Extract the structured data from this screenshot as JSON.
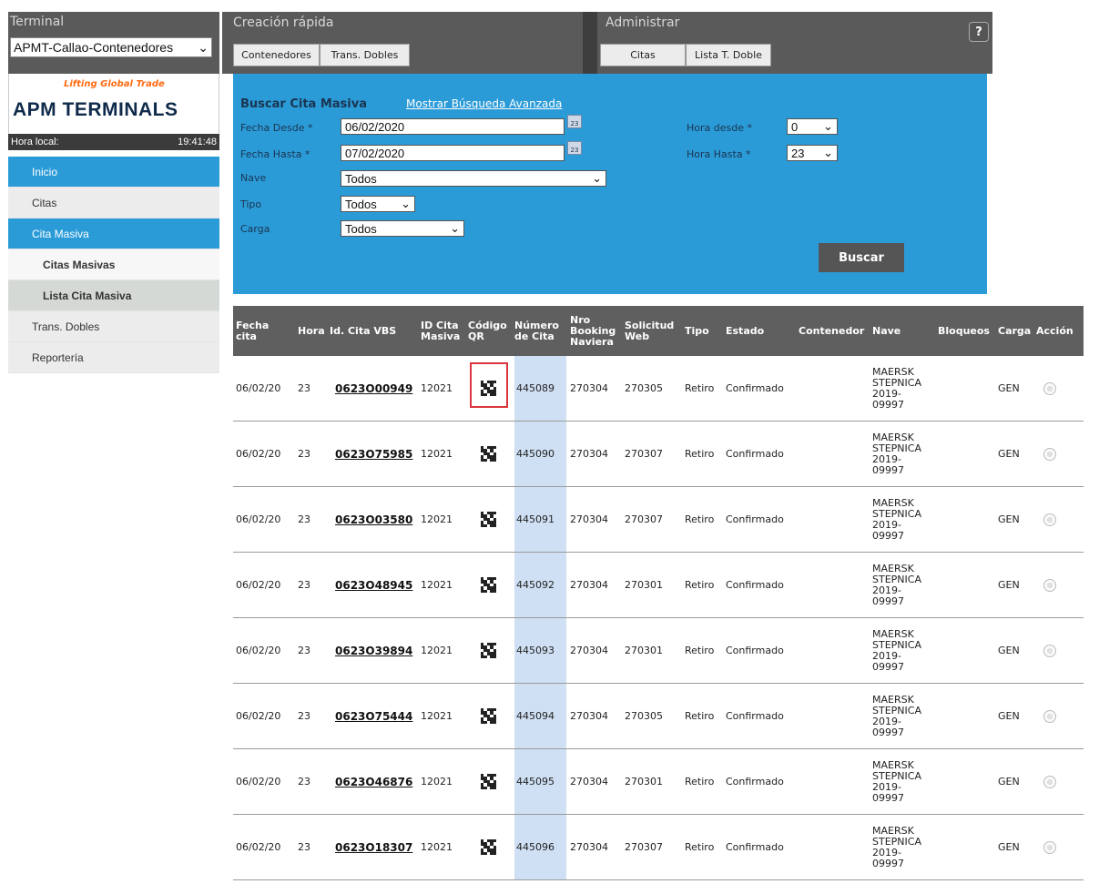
{
  "header": {
    "terminal_title": "Terminal",
    "terminal_value": "APMT-Callao-Contenedores",
    "quick_title": "Creación rápida",
    "quick_buttons": [
      "Contenedores",
      "Trans. Dobles"
    ],
    "admin_title": "Administrar",
    "admin_buttons": [
      "Citas",
      "Lista T. Doble"
    ],
    "help_icon": "help-icon"
  },
  "logo": {
    "tagline": "Lifting Global Trade",
    "name": "APM TERMINALS"
  },
  "local_time": {
    "label": "Hora local:",
    "value": "19:41:48"
  },
  "nav": {
    "items": [
      "Inicio",
      "Citas",
      "Cita Masiva",
      "Citas Masivas",
      "Lista Cita Masiva",
      "Trans. Dobles",
      "Reportería"
    ]
  },
  "search": {
    "title": "Buscar Cita Masiva",
    "advanced_link": "Mostrar Búsqueda Avanzada",
    "fecha_desde_label": "Fecha Desde *",
    "fecha_desde_value": "06/02/2020",
    "fecha_hasta_label": "Fecha Hasta *",
    "fecha_hasta_value": "07/02/2020",
    "nave_label": "Nave",
    "nave_value": "Todos",
    "tipo_label": "Tipo",
    "tipo_value": "Todos",
    "carga_label": "Carga",
    "carga_value": "Todos",
    "hora_desde_label": "Hora desde *",
    "hora_desde_value": "0",
    "hora_hasta_label": "Hora Hasta *",
    "hora_hasta_value": "23",
    "cal_label": "23",
    "buscar_label": "Buscar"
  },
  "table": {
    "headers": {
      "fecha": [
        "Fecha",
        "cita"
      ],
      "hora": "Hora",
      "id_vbs": "Id. Cita VBS",
      "id_masiva": [
        "ID Cita",
        "Masiva"
      ],
      "qr": [
        "Código",
        "QR"
      ],
      "numero": [
        "Número",
        "de Cita"
      ],
      "booking": [
        "Nro",
        "Booking",
        "Naviera"
      ],
      "solicitud": [
        "Solicitud",
        "Web"
      ],
      "tipo": "Tipo",
      "estado": "Estado",
      "contenedor": "Contenedor",
      "nave": "Nave",
      "bloqueos": "Bloqueos",
      "carga": "Carga",
      "accion": "Acción"
    },
    "rows": [
      {
        "fecha": "06/02/20",
        "hora": "23",
        "id_vbs": "0623O00949",
        "id_masiva": "12021",
        "numero": "445089",
        "booking": "270304",
        "solicitud": "270305",
        "tipo": "Retiro",
        "estado": "Confirmado",
        "nave": [
          "MAERSK",
          "STEPNICA",
          "2019-",
          "09997"
        ],
        "carga": "GEN"
      },
      {
        "fecha": "06/02/20",
        "hora": "23",
        "id_vbs": "0623O75985",
        "id_masiva": "12021",
        "numero": "445090",
        "booking": "270304",
        "solicitud": "270307",
        "tipo": "Retiro",
        "estado": "Confirmado",
        "nave": [
          "MAERSK",
          "STEPNICA",
          "2019-",
          "09997"
        ],
        "carga": "GEN"
      },
      {
        "fecha": "06/02/20",
        "hora": "23",
        "id_vbs": "0623O03580",
        "id_masiva": "12021",
        "numero": "445091",
        "booking": "270304",
        "solicitud": "270307",
        "tipo": "Retiro",
        "estado": "Confirmado",
        "nave": [
          "MAERSK",
          "STEPNICA",
          "2019-",
          "09997"
        ],
        "carga": "GEN"
      },
      {
        "fecha": "06/02/20",
        "hora": "23",
        "id_vbs": "0623O48945",
        "id_masiva": "12021",
        "numero": "445092",
        "booking": "270304",
        "solicitud": "270301",
        "tipo": "Retiro",
        "estado": "Confirmado",
        "nave": [
          "MAERSK",
          "STEPNICA",
          "2019-",
          "09997"
        ],
        "carga": "GEN"
      },
      {
        "fecha": "06/02/20",
        "hora": "23",
        "id_vbs": "0623O39894",
        "id_masiva": "12021",
        "numero": "445093",
        "booking": "270304",
        "solicitud": "270301",
        "tipo": "Retiro",
        "estado": "Confirmado",
        "nave": [
          "MAERSK",
          "STEPNICA",
          "2019-",
          "09997"
        ],
        "carga": "GEN"
      },
      {
        "fecha": "06/02/20",
        "hora": "23",
        "id_vbs": "0623O75444",
        "id_masiva": "12021",
        "numero": "445094",
        "booking": "270304",
        "solicitud": "270305",
        "tipo": "Retiro",
        "estado": "Confirmado",
        "nave": [
          "MAERSK",
          "STEPNICA",
          "2019-",
          "09997"
        ],
        "carga": "GEN"
      },
      {
        "fecha": "06/02/20",
        "hora": "23",
        "id_vbs": "0623O46876",
        "id_masiva": "12021",
        "numero": "445095",
        "booking": "270304",
        "solicitud": "270301",
        "tipo": "Retiro",
        "estado": "Confirmado",
        "nave": [
          "MAERSK",
          "STEPNICA",
          "2019-",
          "09997"
        ],
        "carga": "GEN"
      },
      {
        "fecha": "06/02/20",
        "hora": "23",
        "id_vbs": "0623O18307",
        "id_masiva": "12021",
        "numero": "445096",
        "booking": "270304",
        "solicitud": "270307",
        "tipo": "Retiro",
        "estado": "Confirmado",
        "nave": [
          "MAERSK",
          "STEPNICA",
          "2019-",
          "09997"
        ],
        "carga": "GEN"
      }
    ]
  },
  "colors": {
    "accent_blue": "#2b9bd8",
    "header_gray": "#5a5a5a",
    "highlight_col": "#cfe0f4",
    "qr_frame": "#d9363e"
  }
}
